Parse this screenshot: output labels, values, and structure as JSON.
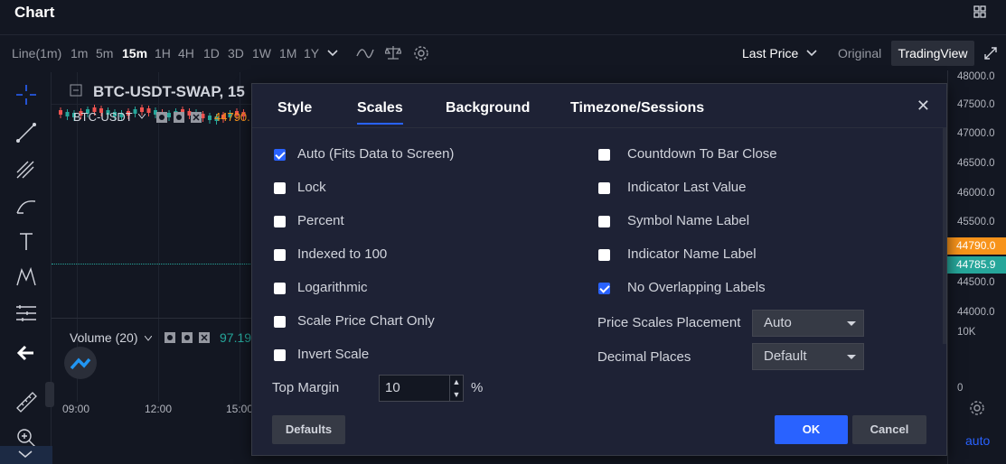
{
  "header": {
    "title": "Chart"
  },
  "toolbar": {
    "intervals": [
      "Line(1m)",
      "1m",
      "5m",
      "15m",
      "1H",
      "4H",
      "1D",
      "3D",
      "1W",
      "1M",
      "1Y"
    ],
    "active_interval": "15m",
    "price_source": "Last Price",
    "mode_original": "Original",
    "mode_tradingview": "TradingView"
  },
  "chart": {
    "symbol": "BTC-USDT-SWAP, 15",
    "series_label": "BTC-USDT",
    "series_price": "44790.",
    "volume_label": "Volume (20)",
    "volume_value": "97.19",
    "price_axis": [
      "48000.0",
      "47500.0",
      "47000.0",
      "46500.0",
      "46000.0",
      "45500.0",
      "45000.0",
      "44500.0",
      "44000.0",
      "10K",
      "0"
    ],
    "tag_last": "44790.0",
    "tag_mark": "44785.9",
    "time_labels": [
      "09:00",
      "12:00",
      "15:00"
    ],
    "auto_label": "auto",
    "colors": {
      "up": "#26a69a",
      "down": "#ef5350",
      "tag_last": "#f7931a",
      "tag_mark": "#26a69a"
    }
  },
  "dialog": {
    "tabs": [
      "Style",
      "Scales",
      "Background",
      "Timezone/Sessions"
    ],
    "active_tab": "Scales",
    "left_options": [
      {
        "label": "Auto (Fits Data to Screen)",
        "checked": true
      },
      {
        "label": "Lock",
        "checked": false
      },
      {
        "label": "Percent",
        "checked": false
      },
      {
        "label": "Indexed to 100",
        "checked": false
      },
      {
        "label": "Logarithmic",
        "checked": false
      },
      {
        "label": "Scale Price Chart Only",
        "checked": false
      },
      {
        "label": "Invert Scale",
        "checked": false
      }
    ],
    "right_options": [
      {
        "label": "Countdown To Bar Close",
        "checked": false
      },
      {
        "label": "Indicator Last Value",
        "checked": false
      },
      {
        "label": "Symbol Name Label",
        "checked": false
      },
      {
        "label": "Indicator Name Label",
        "checked": false
      },
      {
        "label": "No Overlapping Labels",
        "checked": true
      }
    ],
    "price_scales_placement": {
      "label": "Price Scales Placement",
      "value": "Auto"
    },
    "decimal_places": {
      "label": "Decimal Places",
      "value": "Default"
    },
    "top_margin": {
      "label": "Top Margin",
      "value": "10",
      "unit": "%"
    },
    "defaults_label": "Defaults",
    "ok_label": "OK",
    "cancel_label": "Cancel"
  }
}
